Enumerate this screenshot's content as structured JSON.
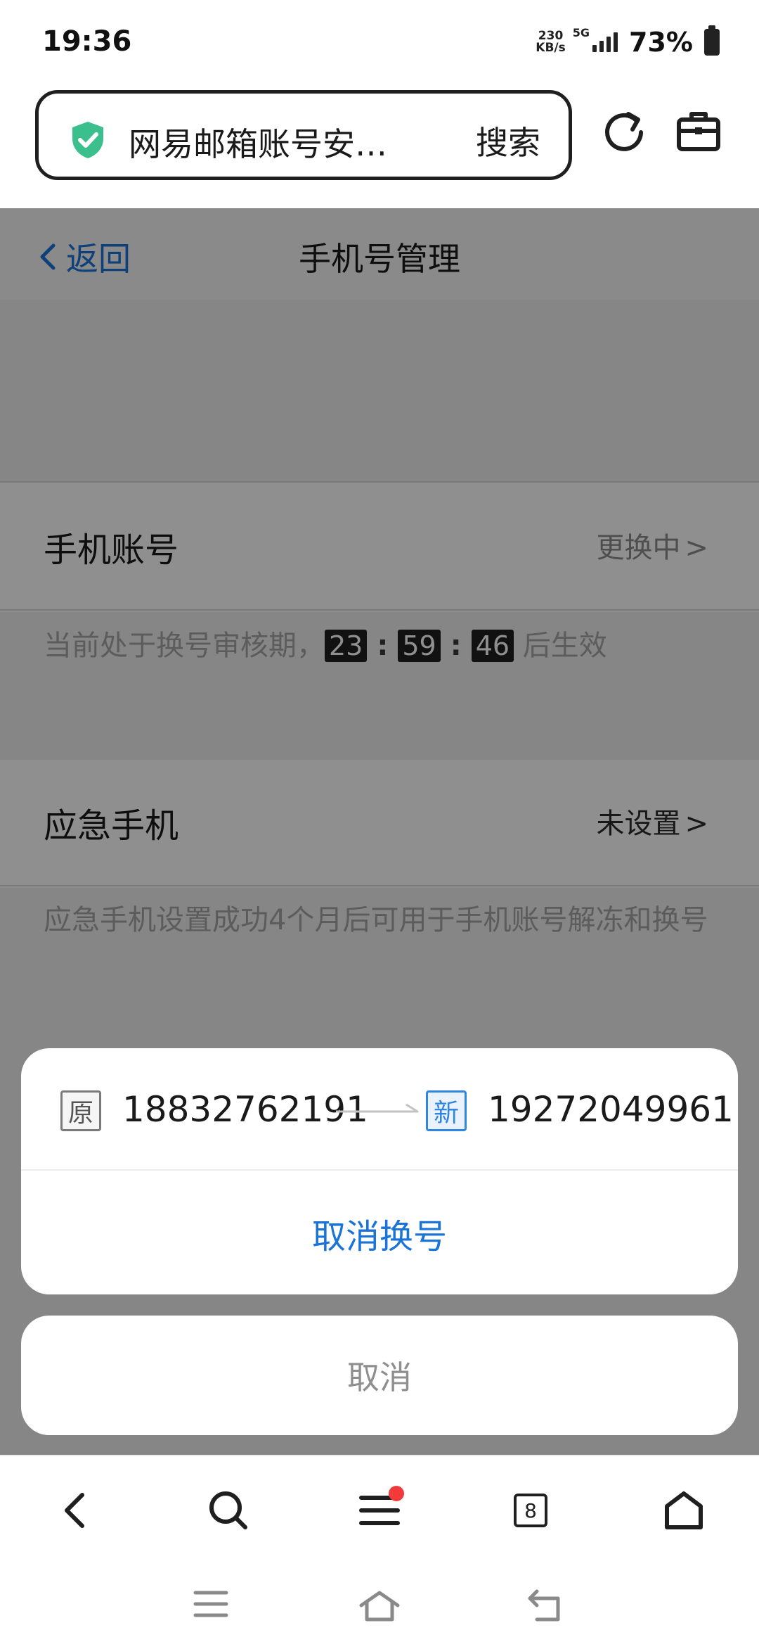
{
  "status_bar": {
    "time": "19:36",
    "net_speed_value": "230",
    "net_speed_unit": "KB/s",
    "network": "5G",
    "battery_percent": "73%"
  },
  "browser": {
    "url_title": "网易邮箱账号安…",
    "search_label": "搜索",
    "icons": [
      "shield-check-icon",
      "refresh-icon",
      "toolbox-icon"
    ],
    "accent_color": "#3bbf8c"
  },
  "page": {
    "back_label": "返回",
    "title": "手机号管理",
    "phone_account": {
      "label": "手机账号",
      "value": "更换中",
      "chevron": ">"
    },
    "review_notice": {
      "prefix": "当前处于换号审核期，",
      "hours": "23",
      "minutes": "59",
      "seconds": "46",
      "separator": ":",
      "suffix": "后生效"
    },
    "emergency_phone": {
      "label": "应急手机",
      "value": "未设置",
      "chevron": ">"
    },
    "emergency_desc": "应急手机设置成功4个月后可用于手机账号解冻和换号"
  },
  "action_sheet": {
    "old_tag": "原",
    "old_number": "18832762191",
    "new_tag": "新",
    "new_number": "19272049961",
    "action_label": "取消换号",
    "cancel_label": "取消",
    "action_color": "#1a73d9"
  },
  "bottom_bar": {
    "tab_count": "8",
    "icons": [
      "back-icon",
      "search-icon",
      "menu-icon",
      "tabs-icon",
      "home-icon"
    ]
  },
  "system_nav": {
    "icons": [
      "recents-icon",
      "home-icon",
      "back-icon"
    ]
  }
}
